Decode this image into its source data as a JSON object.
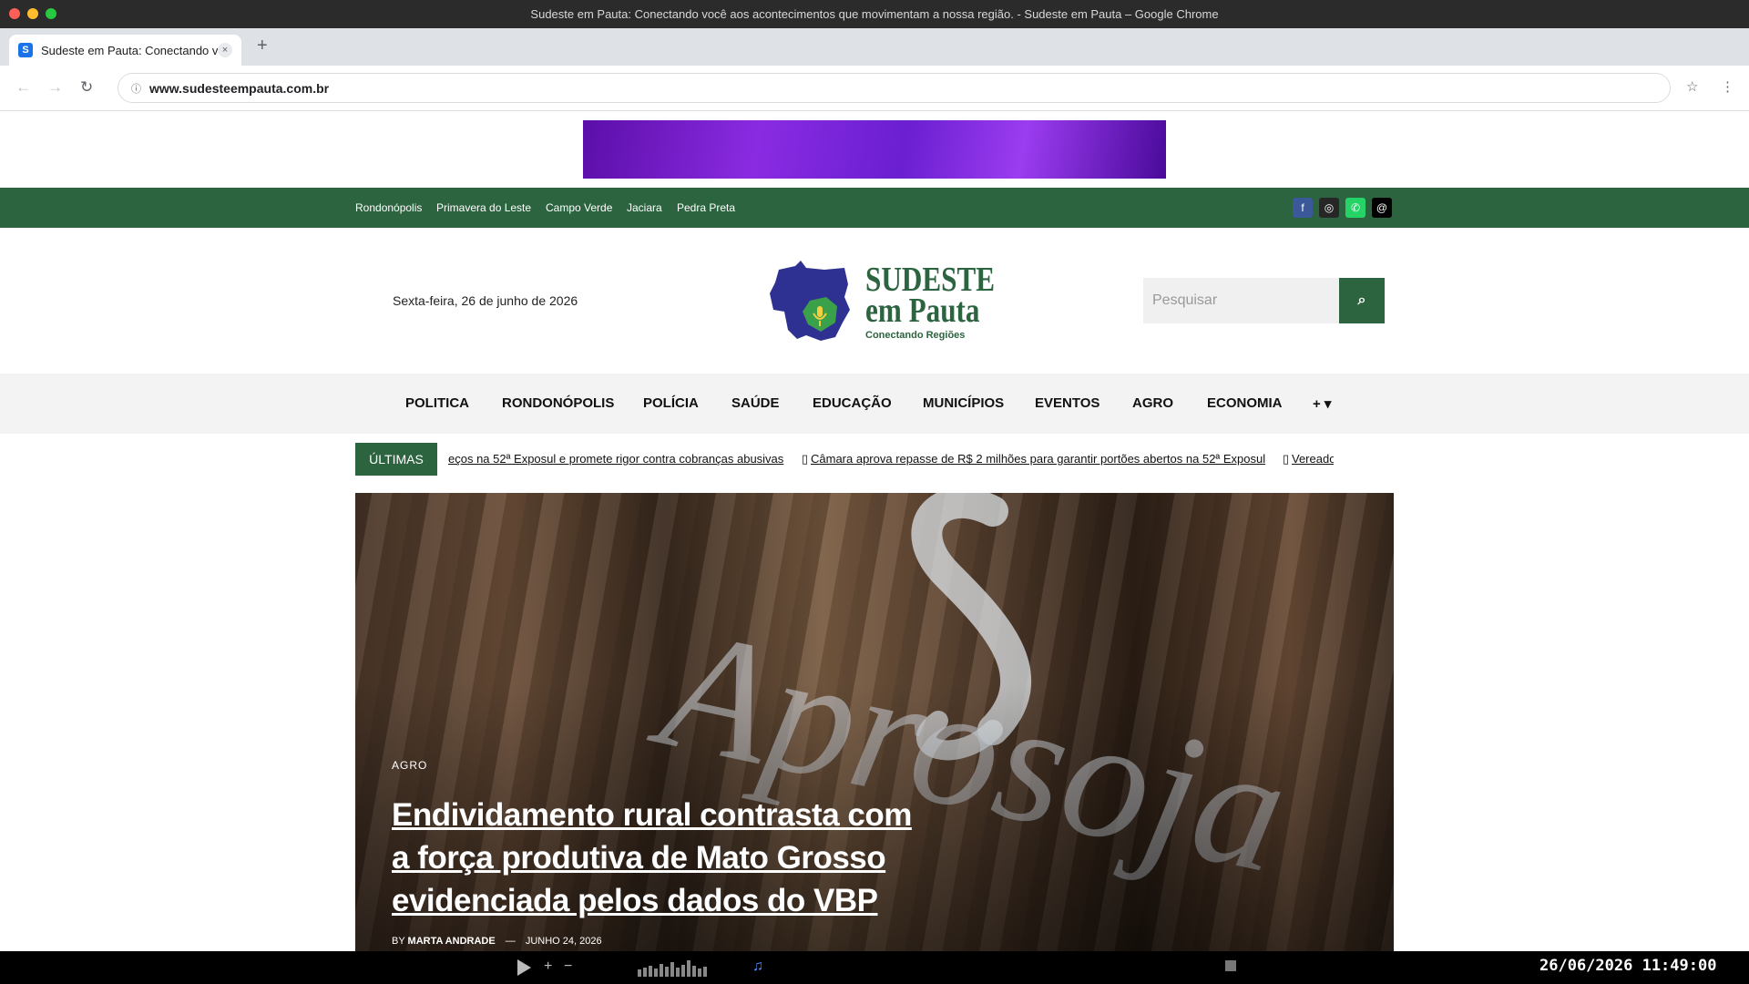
{
  "window": {
    "title": "Sudeste em Pauta: Conectando você aos acontecimentos que movimentam a nossa região. - Sudeste em Pauta – Google Chrome"
  },
  "tab": {
    "title": "Sudeste em Pauta: Conectando v...",
    "favicon_letter": "S",
    "close": "×",
    "new_tab": "+"
  },
  "toolbar": {
    "back": "←",
    "forward": "→",
    "reload": "↻",
    "url": "www.sudesteempauta.com.br",
    "star": "☆",
    "menu": "⋮"
  },
  "topbar": {
    "cities": [
      "Rondonópolis",
      "Primavera do Leste",
      "Campo Verde",
      "Jaciara",
      "Pedra Preta"
    ],
    "social": [
      "facebook-icon",
      "instagram-icon",
      "whatsapp-icon",
      "threads-icon"
    ],
    "social_colors": [
      "#3b5998",
      "#262626",
      "#25d366",
      "#000000"
    ]
  },
  "header": {
    "date": "Sexta-feira, 26 de junho de 2026",
    "logo_line1": "SUDESTE",
    "logo_line2": "em Pauta",
    "logo_tagline": "Conectando Regiões",
    "search_placeholder": "Pesquisar"
  },
  "menu": {
    "items": [
      "POLITICA",
      "RONDONÓPOLIS",
      "POLÍCIA",
      "SAÚDE",
      "EDUCAÇÃO",
      "MUNICÍPIOS",
      "EVENTOS",
      "AGRO",
      "ECONOMIA",
      "+ ▾"
    ]
  },
  "ticker": {
    "label": "ÚLTIMAS",
    "items": [
      "eços na 52ª Exposul e promete rigor contra cobranças abusivas",
      "Câmara aprova repasse de R$ 2 milhões para garantir portões abertos na 52ª Exposul",
      "Vereado"
    ]
  },
  "hero": {
    "category": "AGRO",
    "title": "Endividamento rural contrasta com a força produtiva de Mato Grosso evidenciada pelos dados do VBP",
    "by": "BY",
    "author": "MARTA ANDRADE",
    "separator": "—",
    "date": "JUNHO 24, 2026"
  },
  "taskbar": {
    "clock": "26/06/2026 11:49:00"
  },
  "colors": {
    "brand_green": "#2c6440",
    "ad_purple": "#6a1fd0"
  }
}
